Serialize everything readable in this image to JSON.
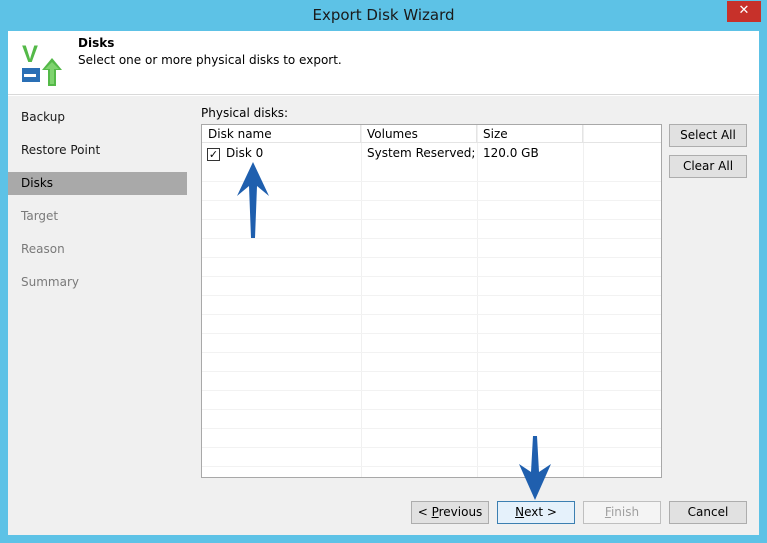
{
  "window": {
    "title": "Export Disk Wizard",
    "close_label": "✕"
  },
  "header": {
    "title": "Disks",
    "description": "Select one or more physical disks to export."
  },
  "steps": [
    {
      "label": "Backup",
      "state": "done"
    },
    {
      "label": "Restore Point",
      "state": "done"
    },
    {
      "label": "Disks",
      "state": "active"
    },
    {
      "label": "Target",
      "state": "disabled"
    },
    {
      "label": "Reason",
      "state": "disabled"
    },
    {
      "label": "Summary",
      "state": "disabled"
    }
  ],
  "disks": {
    "label": "Physical disks:",
    "columns": [
      "Disk name",
      "Volumes",
      "Size"
    ],
    "rows": [
      {
        "checked": true,
        "name": "Disk 0",
        "volumes": "System Reserved; ...",
        "size": "120.0 GB"
      }
    ]
  },
  "side_buttons": {
    "select_all": "Select All",
    "clear_all": "Clear All"
  },
  "footer": {
    "previous_prefix": "< ",
    "previous_mnemonic": "P",
    "previous_rest": "revious",
    "next_mnemonic": "N",
    "next_rest": "ext >",
    "finish_mnemonic": "F",
    "finish_rest": "inish",
    "cancel": "Cancel"
  },
  "colors": {
    "title_bar": "#5dc2e6",
    "active_step": "#a9a9a9",
    "annotation_arrow": "#1f5fae",
    "logo_green": "#54b948"
  }
}
